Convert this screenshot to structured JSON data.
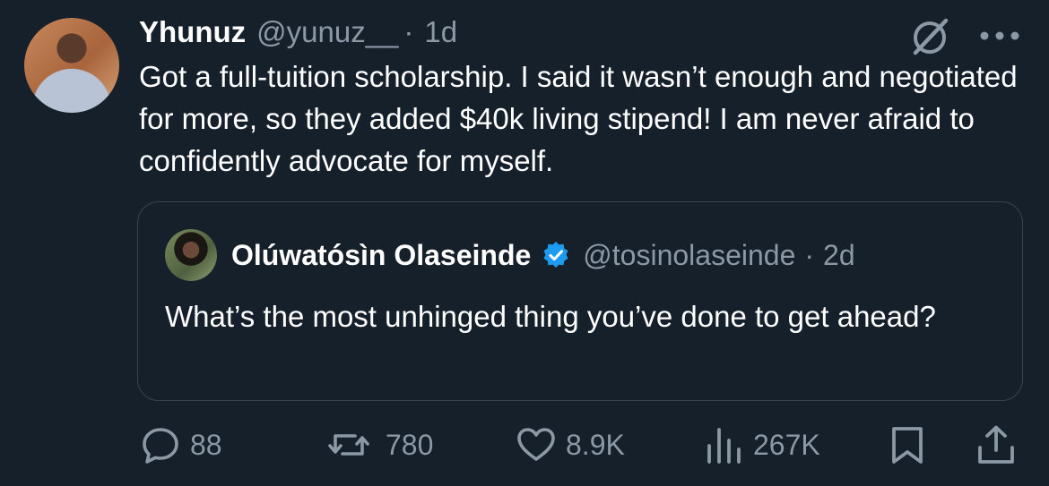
{
  "author": {
    "display_name": "Yhunuz",
    "handle": "@yunuz__",
    "separator": "·",
    "time": "1d"
  },
  "tweet_text": "Got a full-tuition scholarship. I said it wasn’t enough and negotiated for more, so they added $40k living stipend! I am never afraid to confidently advocate for myself.",
  "quoted": {
    "display_name": "Olúwatósìn Olaseinde",
    "verified": true,
    "handle": "@tosinolaseinde",
    "separator": "·",
    "time": "2d",
    "text": "What’s the most unhinged thing you’ve done to get ahead?"
  },
  "actions": {
    "replies": "88",
    "reposts": "780",
    "likes": "8.9K",
    "views": "267K"
  },
  "icons": {
    "header": [
      "grok-icon",
      "more-icon"
    ],
    "action_bar": [
      "reply-icon",
      "repost-icon",
      "like-icon",
      "views-icon",
      "bookmark-icon",
      "share-icon"
    ]
  },
  "colors": {
    "background": "#15202b",
    "text_primary": "#ffffff",
    "text_secondary": "#8b98a5",
    "border": "#38444d",
    "verified": "#1d9bf0"
  }
}
